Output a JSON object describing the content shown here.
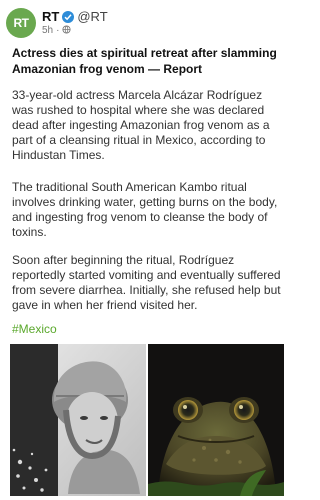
{
  "author": {
    "name": "RT",
    "handle": "@RT",
    "avatar_text": "RT",
    "timestamp": "5h",
    "audience_icon": "globe-icon"
  },
  "post": {
    "headline": "Actress dies at spiritual retreat after slamming Amazonian frog venom — Report",
    "paragraphs": [
      "33-year-old actress Marcela Alcázar Rodríguez was rushed to hospital where she was declared dead after ingesting Amazonian frog venom as a part of a cleansing ritual in Mexico, according to Hindustan Times.",
      "The traditional South American Kambo ritual involves drinking water, getting burns on the body, and ingesting frog venom to cleanse the body of toxins.",
      "Soon after beginning the ritual, Rodríguez reportedly started vomiting and eventually suffered from severe diarrhea. Initially, she refused help but gave in when her friend visited her."
    ],
    "hashtag": "#Mexico"
  },
  "colors": {
    "avatar": "#6aa84f",
    "verified": "#2d8cd8",
    "hashtag": "#5aa82c"
  }
}
